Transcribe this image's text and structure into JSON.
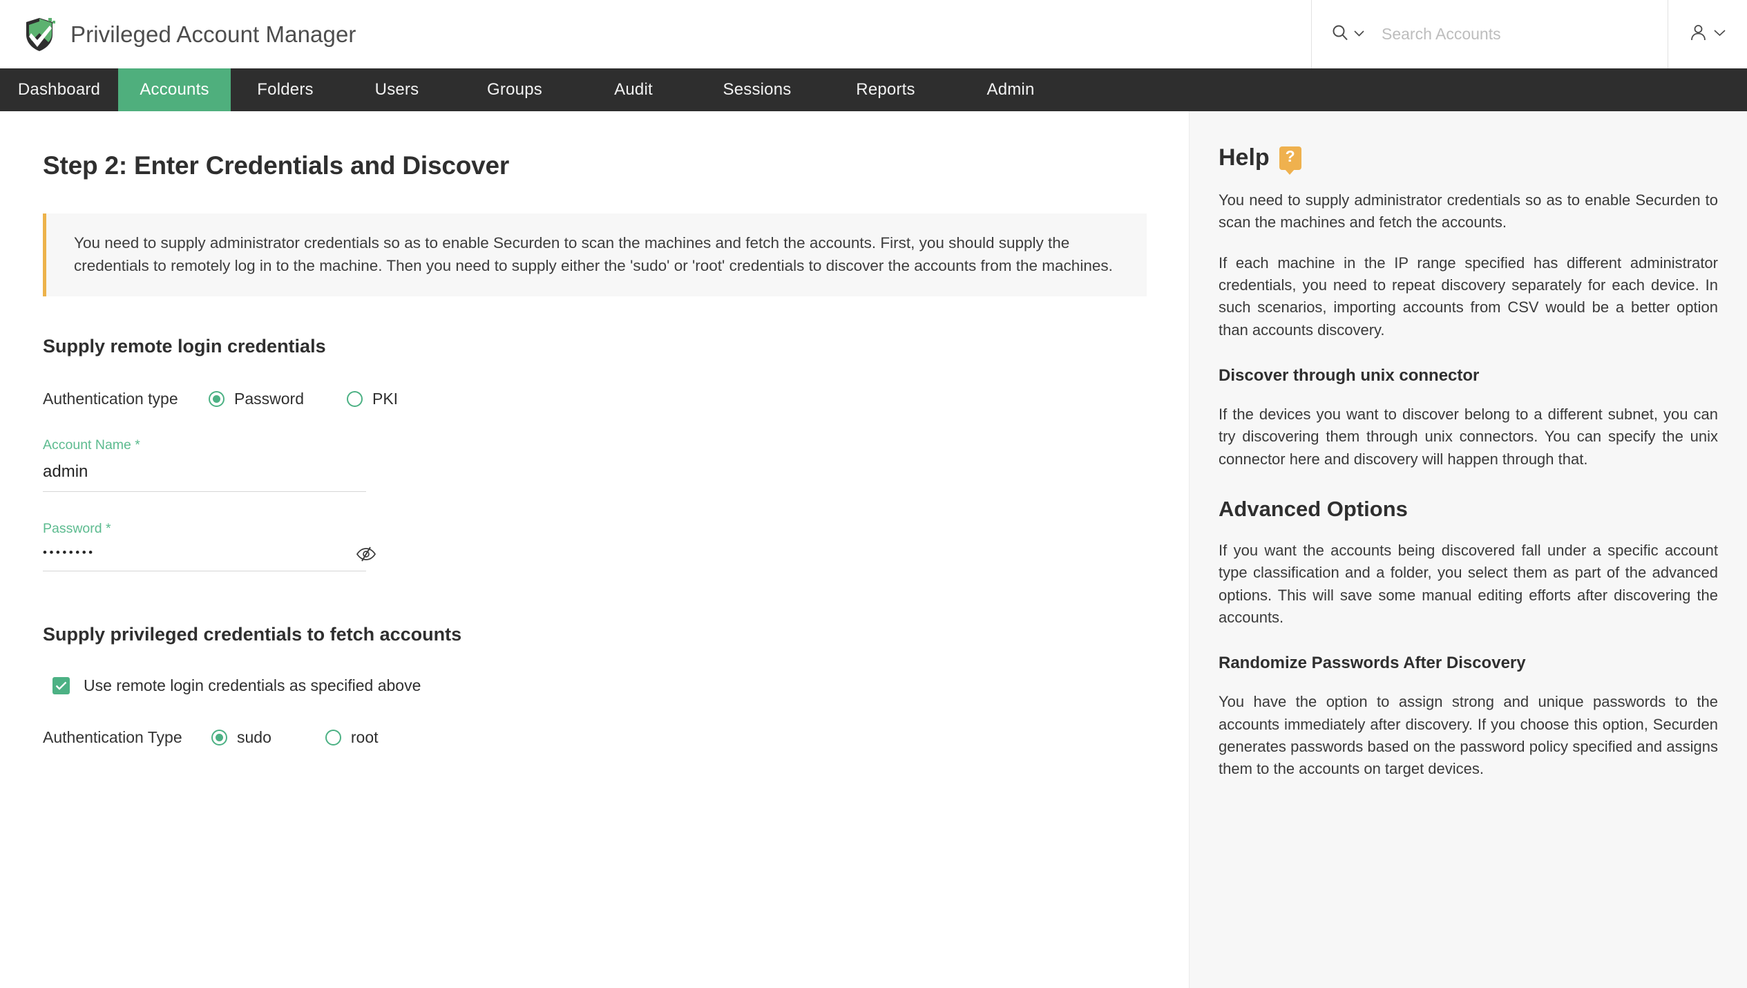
{
  "header": {
    "brand_title": "Privileged Account Manager",
    "logo_icon": "shield-check-logo",
    "search": {
      "icon": "search-icon",
      "dropdown_icon": "chevron-down-icon",
      "placeholder": "Search Accounts",
      "value": ""
    },
    "user": {
      "icon": "user-icon",
      "dropdown_icon": "chevron-down-icon"
    }
  },
  "nav": {
    "active": "Accounts",
    "items": [
      {
        "label": "Dashboard"
      },
      {
        "label": "Accounts"
      },
      {
        "label": "Folders"
      },
      {
        "label": "Users"
      },
      {
        "label": "Groups"
      },
      {
        "label": "Audit"
      },
      {
        "label": "Sessions"
      },
      {
        "label": "Reports"
      },
      {
        "label": "Admin"
      }
    ]
  },
  "main": {
    "page_title": "Step 2: Enter Credentials and Discover",
    "notice": "You need to supply administrator credentials so as to enable Securden to scan the machines and fetch the accounts. First, you should supply the credentials to remotely log in to the machine. Then you need to supply either the 'sudo' or 'root' credentials to discover the accounts from the machines.",
    "remote_section": {
      "heading": "Supply remote login credentials",
      "auth_type_label": "Authentication type",
      "auth_options": [
        {
          "label": "Password",
          "selected": true
        },
        {
          "label": "PKI",
          "selected": false
        }
      ],
      "account_name": {
        "label": "Account Name *",
        "value": "admin"
      },
      "password": {
        "label": "Password *",
        "value": "••••••••",
        "toggle_icon": "eye-off-icon"
      }
    },
    "privileged_section": {
      "heading": "Supply privileged credentials to fetch accounts",
      "use_remote_checkbox": {
        "label": "Use remote login credentials as specified above",
        "checked": true
      },
      "auth_type_label": "Authentication Type",
      "auth_options": [
        {
          "label": "sudo",
          "selected": true
        },
        {
          "label": "root",
          "selected": false
        }
      ]
    }
  },
  "help": {
    "title": "Help",
    "badge_icon": "question-mark-icon",
    "badge_text": "?",
    "paragraph_1": "You need to supply administrator credentials so as to enable Securden to scan the machines and fetch the accounts.",
    "paragraph_2": "If each machine in the IP range specified has different administrator credentials, you need to repeat discovery separately for each device. In such scenarios, importing accounts from CSV would be a better option than accounts discovery.",
    "section_unix_title": "Discover through unix connector",
    "section_unix_body": "If the devices you want to discover belong to a different subnet, you can try discovering them through unix connectors. You can specify the unix connector here and discovery will happen through that.",
    "section_advanced_title": "Advanced Options",
    "section_advanced_body": "If you want the accounts being discovered fall under a specific account type classification and a folder, you select them as part of the advanced options. This will save some manual editing efforts after discovering the accounts.",
    "section_randomize_title": "Randomize Passwords After Discovery",
    "section_randomize_body": "You have the option to assign strong and unique passwords to the accounts immediately after discovery. If you choose this option, Securden generates passwords based on the password policy specified and assigns them to the accounts on target devices."
  },
  "colors": {
    "accent_green": "#4faf7d",
    "nav_dark": "#2e2e2e",
    "notice_border": "#edb24a",
    "help_badge": "#efb14e"
  }
}
